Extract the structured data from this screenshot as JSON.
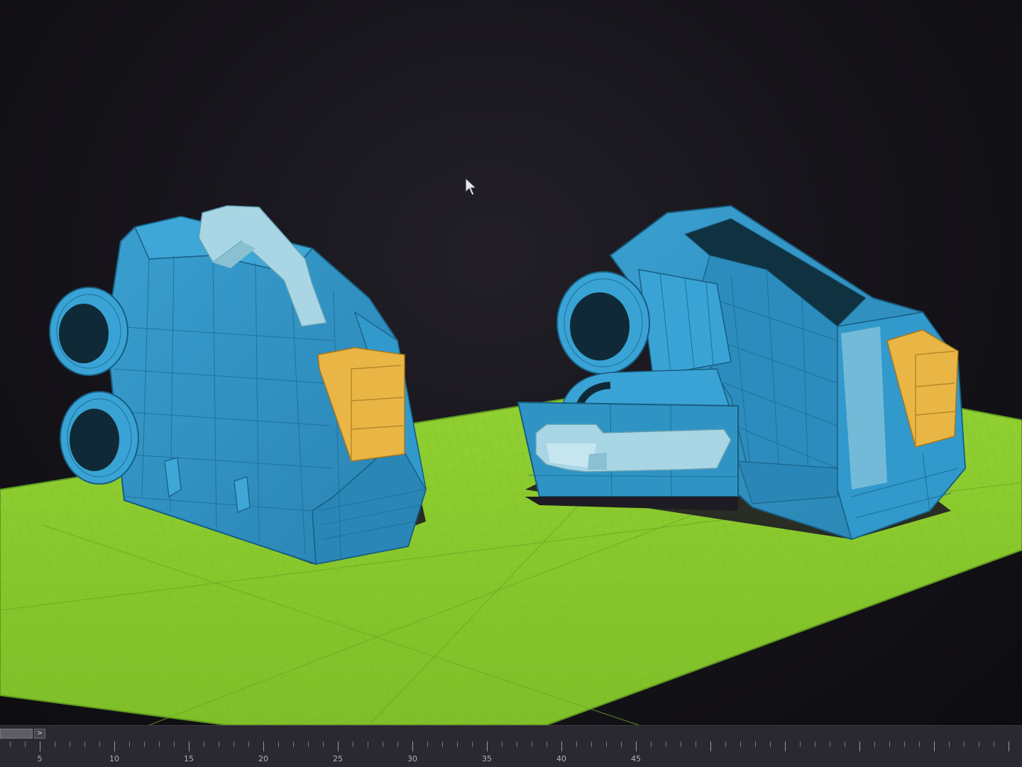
{
  "viewport": {
    "background": "#16141a",
    "ground_color": "#8ccc2e",
    "model_color": "#2f94c4",
    "accent_panel_color": "#e9b545",
    "handle_color": "#a9d6e4"
  },
  "timeline": {
    "next_button_label": ">",
    "ruler_labels": [
      "5",
      "10",
      "15",
      "20",
      "25",
      "30",
      "35",
      "40",
      "45"
    ]
  },
  "icons": {
    "cursor": "arrow-cursor-icon"
  }
}
